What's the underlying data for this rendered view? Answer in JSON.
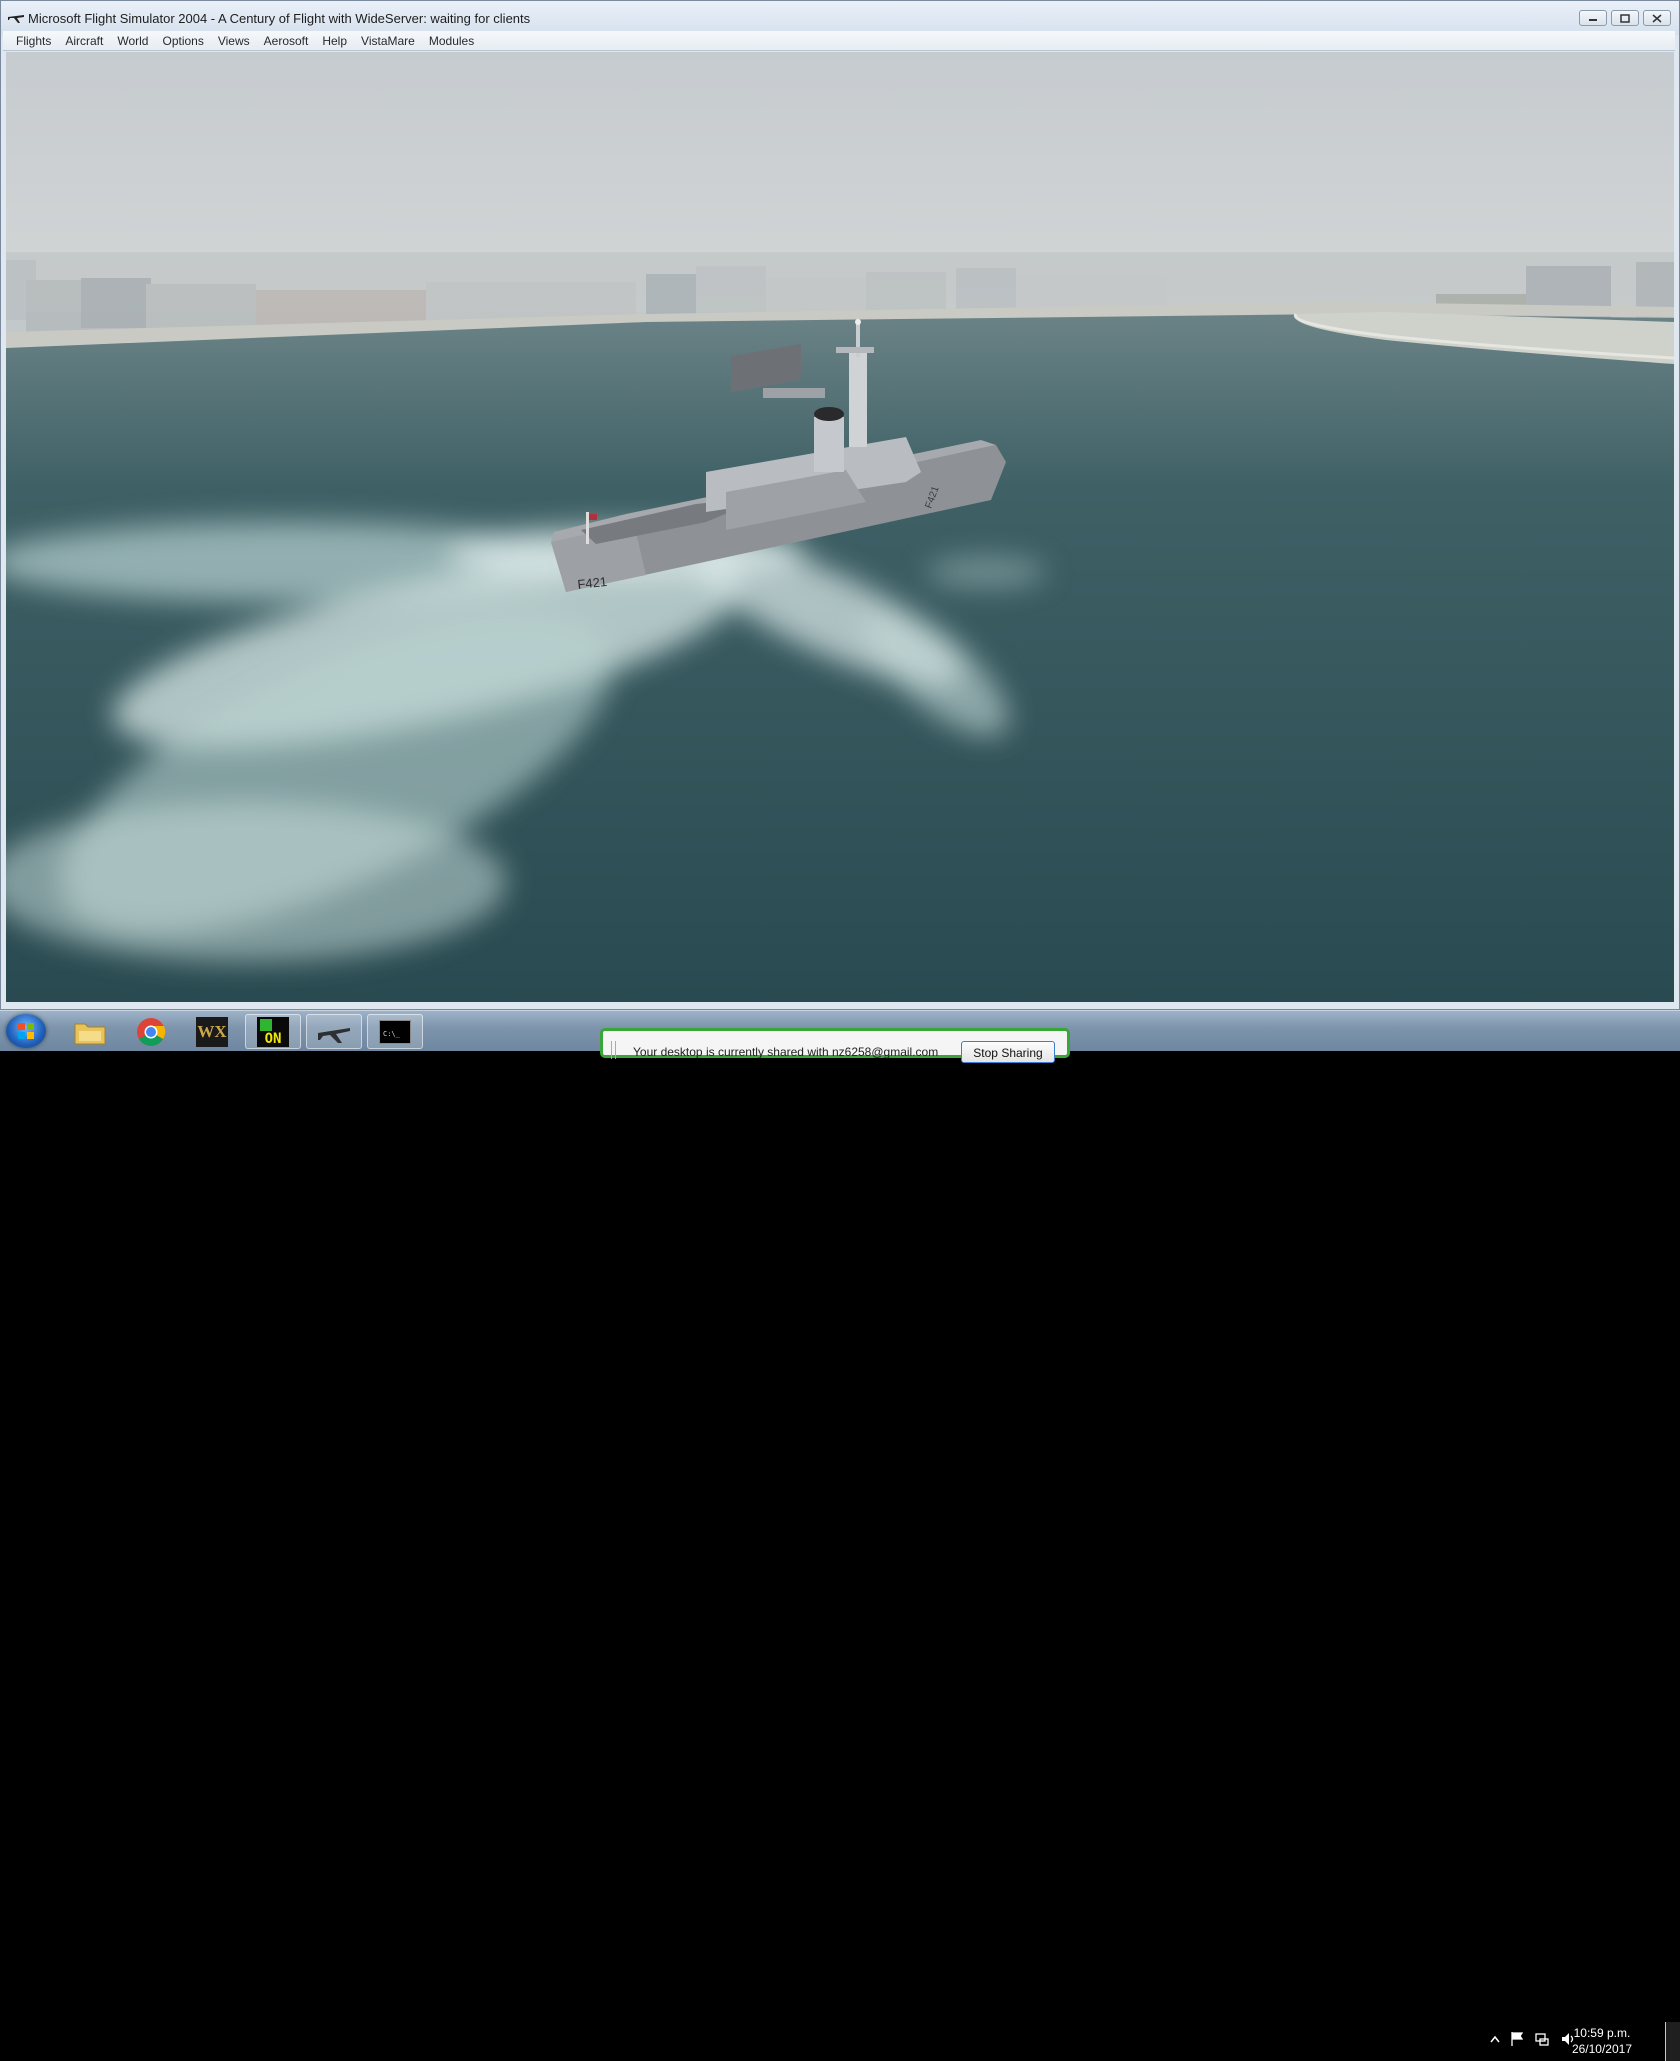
{
  "window": {
    "title": "Microsoft Flight Simulator 2004 - A Century of Flight with WideServer: waiting for clients",
    "controls": [
      "minimize",
      "restore",
      "close"
    ]
  },
  "menu": {
    "items": [
      "Flights",
      "Aircraft",
      "World",
      "Options",
      "Views",
      "Aerosoft",
      "Help",
      "VistaMare",
      "Modules"
    ]
  },
  "scene": {
    "ship_hull_number_stern": "F421",
    "ship_hull_number_side": "F421"
  },
  "taskbar": {
    "icons": [
      "windows-start",
      "file-explorer",
      "chrome",
      "wx",
      "on",
      "flight-simulator",
      "command-prompt"
    ],
    "wx_label": "WX",
    "on_label": "ON",
    "cmd_label": "C:\\_"
  },
  "share": {
    "text": "Your desktop is currently shared with nz6258@gmail.com",
    "stop_label": "Stop Sharing"
  },
  "clock": {
    "time": "10:59 p.m.",
    "date": "26/10/2017"
  },
  "colors": {
    "sky": "#c8cdd0",
    "water": "#2f5258",
    "share_border": "#3aa63a"
  }
}
